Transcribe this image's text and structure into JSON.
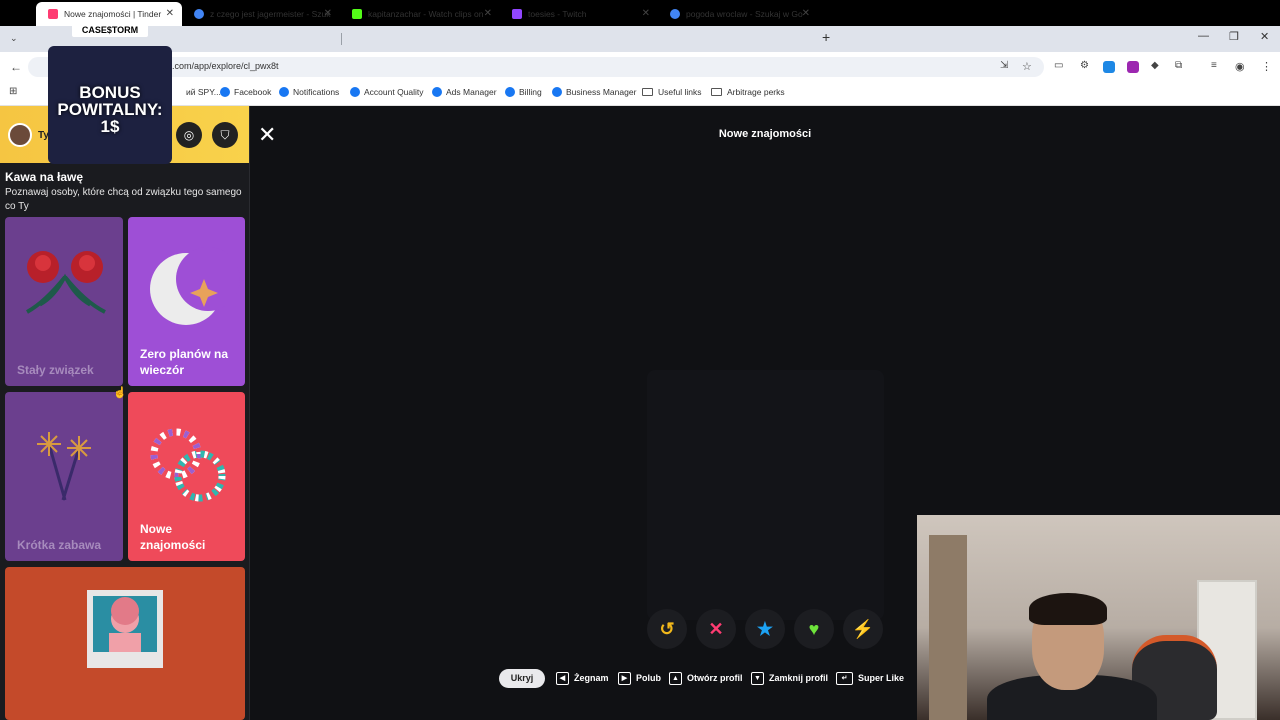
{
  "browser": {
    "tabs": [
      {
        "title": "Nowe znajomości | Tinder",
        "active": true,
        "color": "#fe3c72"
      },
      {
        "title": "z czego jest jagermeister - Szuk",
        "active": false,
        "color": "#4285f4"
      },
      {
        "title": "kapitanzachar - Watch clips on",
        "active": false,
        "color": "#53fc18"
      },
      {
        "title": "toesies - Twitch",
        "active": false,
        "color": "#9146ff"
      },
      {
        "title": "pogoda wroclaw - Szukaj w Go",
        "active": false,
        "color": "#4285f4"
      }
    ],
    "new_tab": "+",
    "url": ".com/app/explore/cl_pwx8t",
    "bookmarks": [
      {
        "label": "ий SPY...",
        "type": "site"
      },
      {
        "label": "Facebook",
        "type": "fb"
      },
      {
        "label": "Notifications",
        "type": "fb"
      },
      {
        "label": "Account Quality",
        "type": "fb"
      },
      {
        "label": "Ads Manager",
        "type": "fb"
      },
      {
        "label": "Billing",
        "type": "fb"
      },
      {
        "label": "Business Manager",
        "type": "fb"
      },
      {
        "label": "Useful links",
        "type": "folder"
      },
      {
        "label": "Arbitrage perks",
        "type": "folder"
      }
    ]
  },
  "overlay": {
    "logo": "CASE$TORM",
    "promo": "BONUS POWITALNY: 1$"
  },
  "sidebar": {
    "user_initial": "Ty",
    "title": "Kawa na ławę",
    "subtitle": "Poznawaj osoby, które chcą od związku tego samego co Ty",
    "cards": [
      {
        "label": "Stały związek",
        "bg": "#6b3f8e",
        "icon": "roses-icon"
      },
      {
        "label": "Zero planów na wieczór",
        "bg": "#9e4fd6",
        "icon": "moon-icon"
      },
      {
        "label": "Krótka zabawa",
        "bg": "#6b3f8e",
        "icon": "sparklers-icon"
      },
      {
        "label": "Nowe znajomości",
        "bg": "#ef4a5a",
        "icon": "bracelets-icon"
      },
      {
        "label": "",
        "bg": "#c44a2a",
        "icon": "photo-icon"
      }
    ]
  },
  "main": {
    "title": "Nowe znajomości",
    "actions": [
      {
        "name": "rewind",
        "glyph": "↺",
        "color": "#f2b81b"
      },
      {
        "name": "nope",
        "glyph": "✕",
        "color": "#fe3c72"
      },
      {
        "name": "super-like",
        "glyph": "★",
        "color": "#1ca3f5"
      },
      {
        "name": "like",
        "glyph": "♥",
        "color": "#6ee33b"
      },
      {
        "name": "boost",
        "glyph": "⚡",
        "color": "#b44cf5"
      }
    ],
    "hints": {
      "hide": "Ukryj",
      "nope": "Żegnam",
      "like": "Polub",
      "open": "Otwórz profil",
      "close": "Zamknij profil",
      "super": "Super Like"
    }
  }
}
